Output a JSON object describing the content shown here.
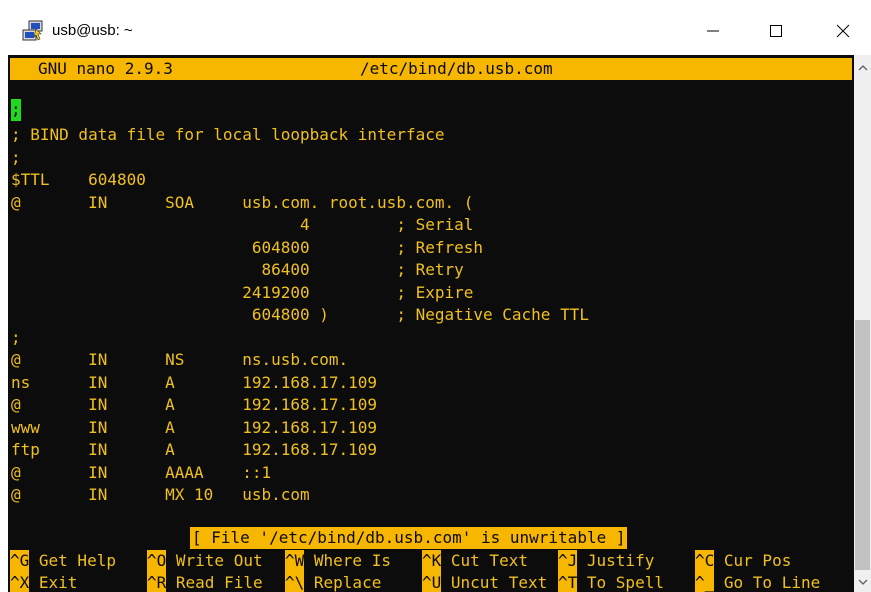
{
  "window": {
    "title": "usb@usb: ~",
    "icon": "putty-icon",
    "controls": {
      "minimize": "minimize-icon",
      "maximize": "maximize-icon",
      "close": "close-icon"
    }
  },
  "nano": {
    "version": "GNU nano 2.9.3",
    "filename": "/etc/bind/db.usb.com",
    "cursor_char": ";",
    "status_message": "[ File '/etc/bind/db.usb.com' is unwritable ]"
  },
  "file_lines": [
    "; BIND data file for local loopback interface",
    ";",
    "$TTL    604800",
    "@       IN      SOA     usb.com. root.usb.com. (",
    "                              4         ; Serial",
    "                         604800         ; Refresh",
    "                          86400         ; Retry",
    "                        2419200         ; Expire",
    "                         604800 )       ; Negative Cache TTL",
    ";",
    "@       IN      NS      ns.usb.com.",
    "ns      IN      A       192.168.17.109",
    "@       IN      A       192.168.17.109",
    "www     IN      A       192.168.17.109",
    "ftp     IN      A       192.168.17.109",
    "@       IN      AAAA    ::1",
    "@       IN      MX 10   usb.com"
  ],
  "shortcuts_row1": [
    {
      "key": "^G",
      "label": " Get Help"
    },
    {
      "key": "^O",
      "label": " Write Out"
    },
    {
      "key": "^W",
      "label": " Where Is"
    },
    {
      "key": "^K",
      "label": " Cut Text"
    },
    {
      "key": "^J",
      "label": " Justify"
    },
    {
      "key": "^C",
      "label": " Cur Pos"
    }
  ],
  "shortcuts_row2": [
    {
      "key": "^X",
      "label": " Exit"
    },
    {
      "key": "^R",
      "label": " Read File"
    },
    {
      "key": "^\\",
      "label": " Replace"
    },
    {
      "key": "^U",
      "label": " Uncut Text"
    },
    {
      "key": "^T",
      "label": " To Spell"
    },
    {
      "key": "^_",
      "label": " Go To Line"
    }
  ],
  "colors": {
    "terminal_bg": "#0c0c0c",
    "text": "#f0c020",
    "highlight": "#f7b600",
    "cursor": "#20d820"
  }
}
